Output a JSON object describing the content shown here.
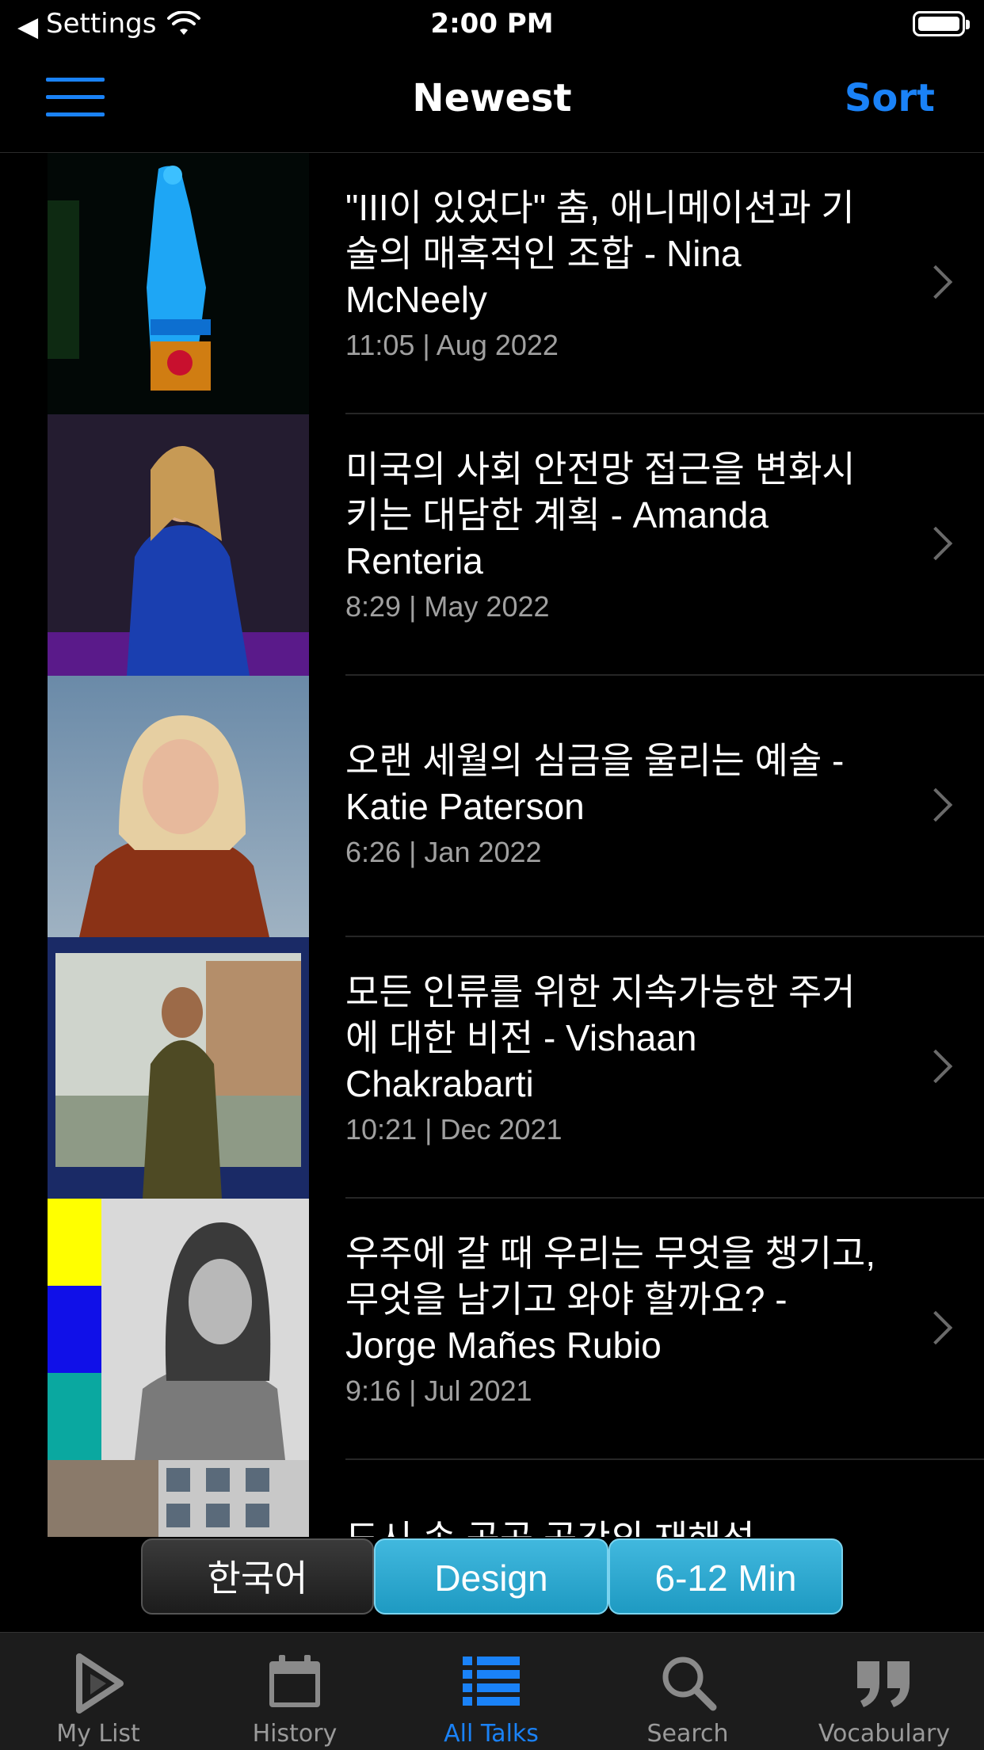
{
  "status_bar": {
    "back_arrow": "◀",
    "carrier": "Settings",
    "time": "2:00 PM"
  },
  "nav": {
    "title": "Newest",
    "sort_label": "Sort"
  },
  "talks": [
    {
      "title": "\"III이 있었다\" 춤, 애니메이션과 기술의 매혹적인 조합 - Nina McNeely",
      "meta": "11:05 | Aug 2022"
    },
    {
      "title": "미국의 사회 안전망 접근을 변화시키는 대담한 계획 - Amanda Renteria",
      "meta": "8:29 | May 2022"
    },
    {
      "title": "오랜 세월의 심금을 울리는 예술 - Katie Paterson",
      "meta": "6:26 | Jan 2022"
    },
    {
      "title": "모든 인류를 위한 지속가능한 주거에 대한 비전 - Vishaan Chakrabarti",
      "meta": "10:21 | Dec 2021"
    },
    {
      "title": "우주에 갈 때 우리는 무엇을 챙기고, 무엇을 남기고 와야 할까요? - Jorge Mañes Rubio",
      "meta": "9:16 | Jul 2021"
    },
    {
      "title": "도시 속 공공 공간의 재해석",
      "meta": ""
    }
  ],
  "filters": {
    "language": "한국어",
    "category": "Design",
    "duration": "6-12 Min"
  },
  "tabs": [
    {
      "label": "My List",
      "icon": "play-icon"
    },
    {
      "label": "History",
      "icon": "calendar-icon"
    },
    {
      "label": "All Talks",
      "icon": "list-icon"
    },
    {
      "label": "Search",
      "icon": "search-icon"
    },
    {
      "label": "Vocabulary",
      "icon": "quote-icon"
    }
  ],
  "colors": {
    "accent": "#1a82f7",
    "filter_active": "#2aa8d2"
  }
}
